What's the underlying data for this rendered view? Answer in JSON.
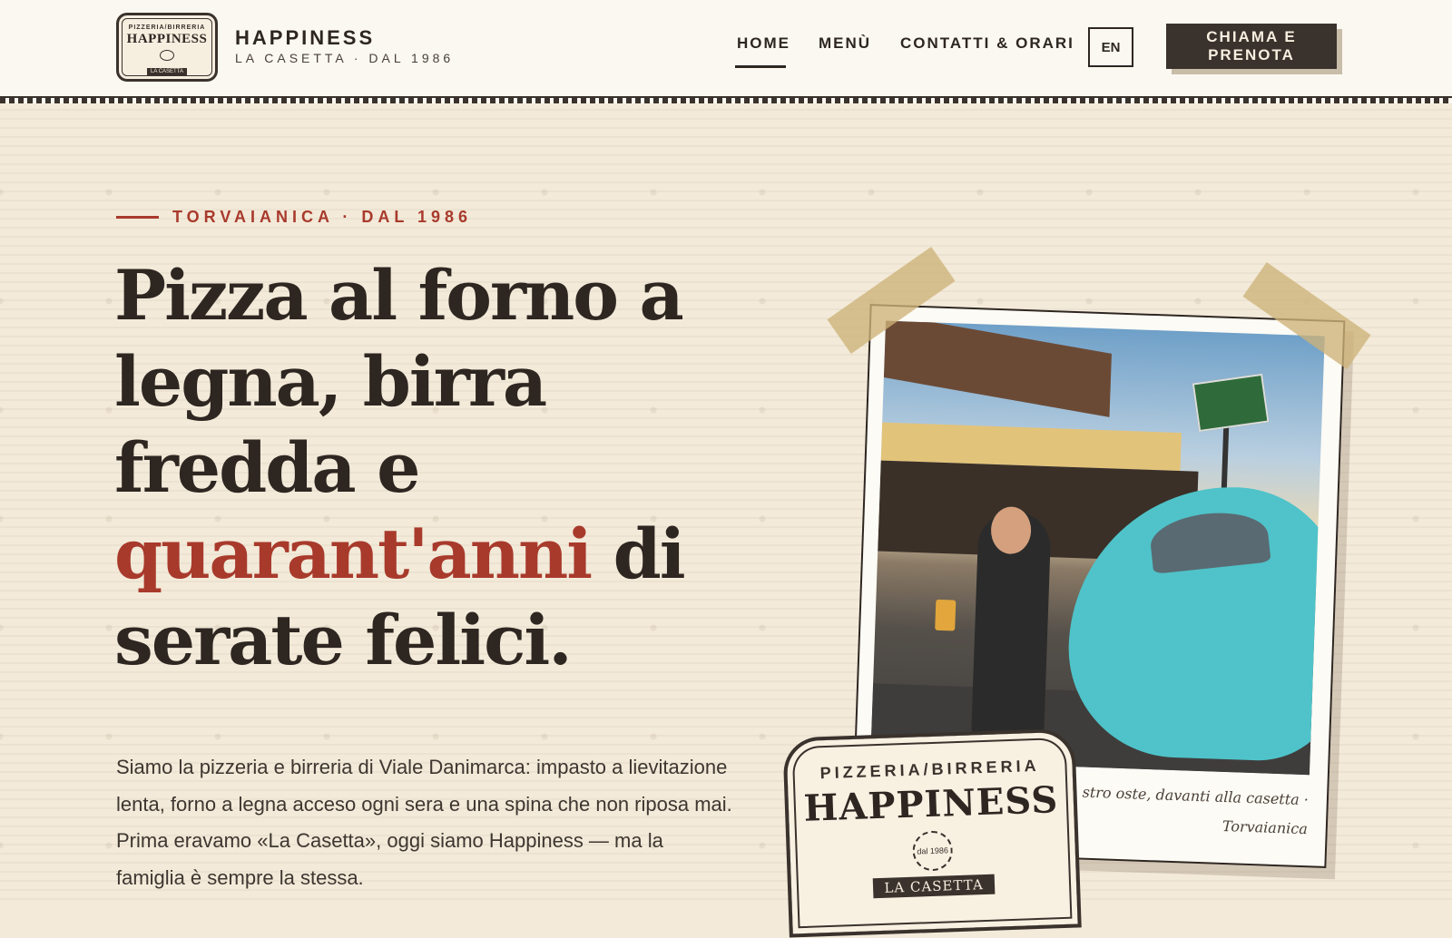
{
  "header": {
    "logo": {
      "small_text": "PIZZERIA/BIRRERIA",
      "name": "HAPPINESS",
      "strip": "LA CASETTA"
    },
    "brand_name": "HAPPINESS",
    "brand_sub": "LA CASETTA · DAL 1986",
    "nav": {
      "home": "HOME",
      "menu": "MENÙ",
      "contact": "CONTATTI & ORARI"
    },
    "lang": "EN",
    "cta": "CHIAMA E PRENOTA"
  },
  "hero": {
    "eyebrow": "TORVAIANICA · DAL 1986",
    "headline_part1": "Pizza al forno a legna, birra fredda e ",
    "headline_accent": "quarant'anni",
    "headline_part2": " di serate felici.",
    "intro": "Siamo la pizzeria e birreria di Viale Danimarca: impasto a lievitazione lenta, forno a legna acceso ogni sera e una spina che non riposa mai. Prima eravamo «La Casetta», oggi siamo Happiness — ma la famiglia è sempre la stessa."
  },
  "photo": {
    "caption": "stro oste, davanti alla casetta · Torvaianica"
  },
  "stamp": {
    "top": "PIZZERIA/BIRRERIA",
    "name": "HAPPINESS",
    "seal": "dal 1986",
    "strip": "LA CASETTA"
  },
  "colors": {
    "accent": "#a83a2c",
    "ink": "#2e2621",
    "paper": "#f3ead9"
  }
}
